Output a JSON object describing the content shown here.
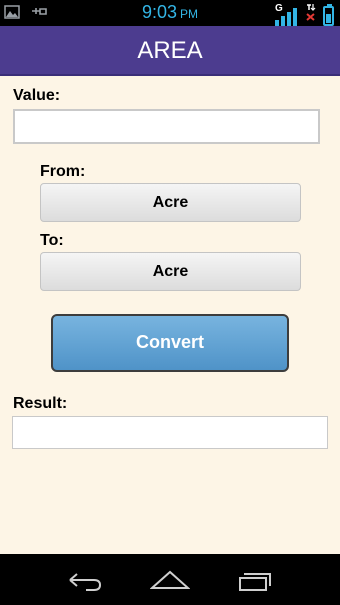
{
  "status_bar": {
    "time": "9:03",
    "ampm": "PM",
    "network_label": "G",
    "icons": [
      "picture-icon",
      "usb-icon",
      "signal-icon",
      "no-data-icon",
      "battery-icon"
    ],
    "accent_color": "#33b5e5"
  },
  "header": {
    "title": "AREA",
    "color": "#4c3c8f"
  },
  "form": {
    "value_label": "Value:",
    "value": "",
    "from_label": "From:",
    "from_selected": "Acre",
    "to_label": "To:",
    "to_selected": "Acre",
    "convert_label": "Convert",
    "result_label": "Result:",
    "result_value": "",
    "background": "#fdf5e6"
  },
  "nav_bar": {
    "icons": [
      "back-icon",
      "home-icon",
      "recent-apps-icon"
    ]
  }
}
